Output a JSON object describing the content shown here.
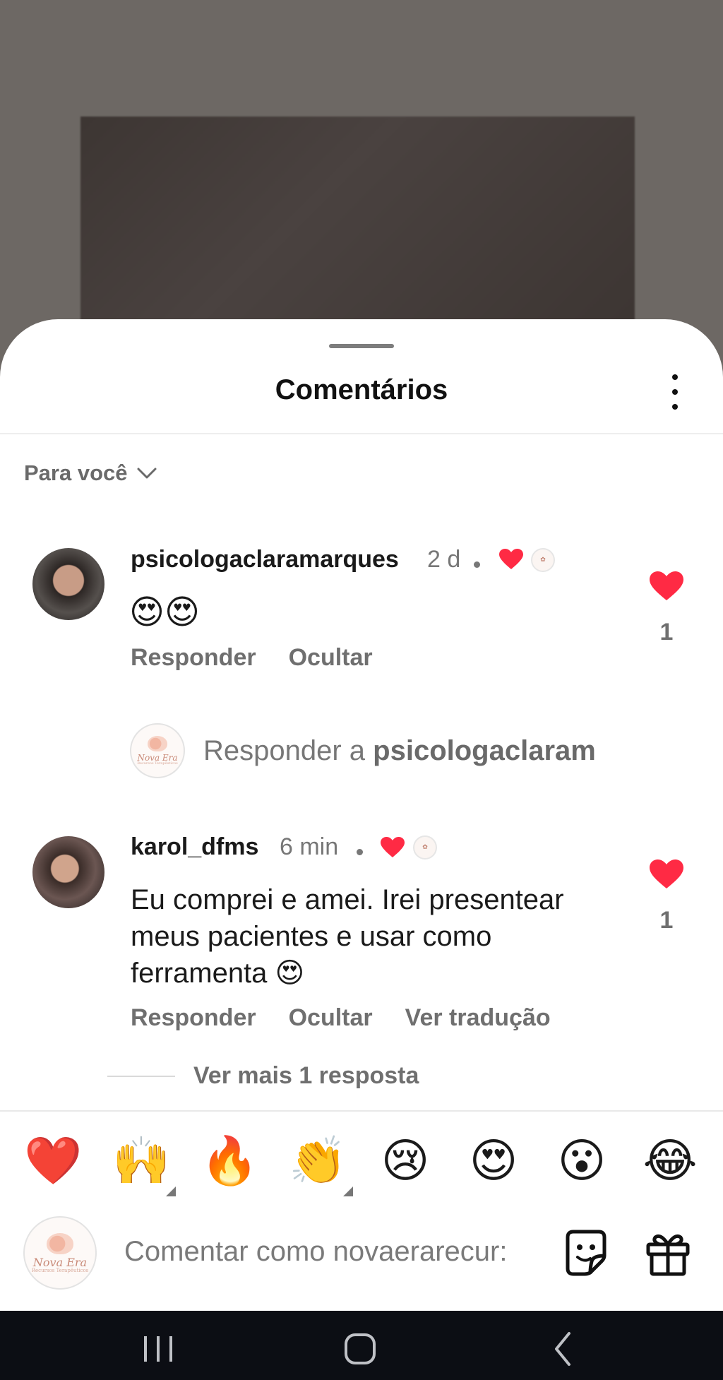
{
  "sheet": {
    "title": "Comentários",
    "filter_label": "Para você"
  },
  "comments": [
    {
      "username": "psicologaclaramarques",
      "time": "2 d",
      "text": "😍😍",
      "likes": "1",
      "actions": [
        "Responder",
        "Ocultar"
      ]
    },
    {
      "username": "karol_dfms",
      "time": "6 min",
      "text_lines": [
        "Eu comprei e amei. Irei presentear",
        "meus pacientes e usar como",
        "ferramenta 😍"
      ],
      "likes": "1",
      "actions": [
        "Responder",
        "Ocultar",
        "Ver tradução"
      ]
    }
  ],
  "reply_prompt": {
    "prefix": "Responder a ",
    "target": "psicologaclaram"
  },
  "more_replies": "Ver mais 1 resposta",
  "brand_avatar": {
    "name": "Nova Era",
    "subtitle": "Recursos Terapêuticos"
  },
  "emoji_bar": [
    "❤️",
    "🙌",
    "🔥",
    "👏",
    "😢",
    "😍",
    "😮",
    "😂"
  ],
  "composer": {
    "placeholder": "Comentar como novaerarecur:"
  },
  "colors": {
    "heart_red": "#ff2a44",
    "muted_text": "#6f6f6f",
    "nav_bg": "#0c0e14"
  },
  "icons": [
    "more-vert-icon",
    "chevron-down-icon",
    "heart-icon",
    "sticker-icon",
    "gift-icon",
    "recents-icon",
    "home-icon",
    "back-icon"
  ]
}
